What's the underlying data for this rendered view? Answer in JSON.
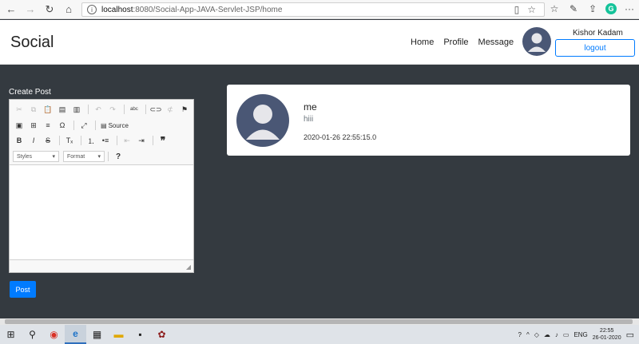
{
  "browser": {
    "url_host": "localhost",
    "url_path": ":8080/Social-App-JAVA-Servlet-JSP/home",
    "icons": [
      "back-icon",
      "forward-icon",
      "refresh-icon",
      "home-icon",
      "info-icon",
      "reading-view-icon",
      "favorite-star-icon",
      "favorites-icon",
      "pen-icon",
      "share-icon",
      "grammarly-icon",
      "more-icon"
    ]
  },
  "navbar": {
    "brand": "Social",
    "links": [
      "Home",
      "Profile",
      "Message"
    ],
    "username": "Kishor Kadam",
    "logout_label": "logout"
  },
  "create_post": {
    "title": "Create Post",
    "toolbar": {
      "source_label": "Source",
      "styles_label": "Styles",
      "format_label": "Format",
      "help_label": "?"
    },
    "post_button": "Post"
  },
  "posts": [
    {
      "author": "me",
      "text": "hiii",
      "date": "2020-01-26 22:55:15.0"
    }
  ],
  "taskbar": {
    "language": "ENG",
    "time": "22:55",
    "date": "26-01-2020"
  },
  "colors": {
    "page_bg": "#343a40",
    "primary": "#007bff",
    "avatar": "#4a5775"
  }
}
